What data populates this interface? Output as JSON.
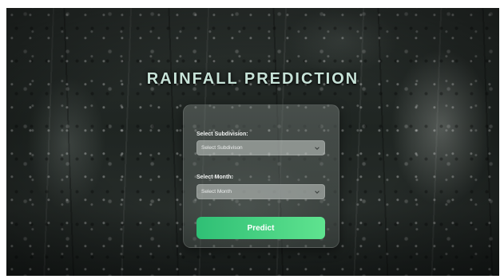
{
  "page": {
    "title": "RAINFALL PREDICTION"
  },
  "form": {
    "subdivision_label": "Select Subdivision:",
    "subdivision_placeholder": "Select Subdivison",
    "month_label": "Select Month:",
    "month_placeholder": "Select Month",
    "predict_label": "Predict"
  },
  "icons": {
    "dropdown": "chevron-down-icon"
  },
  "colors": {
    "button_start": "#2fbf75",
    "button_end": "#5fe38f",
    "title": "#c7e3d8"
  }
}
